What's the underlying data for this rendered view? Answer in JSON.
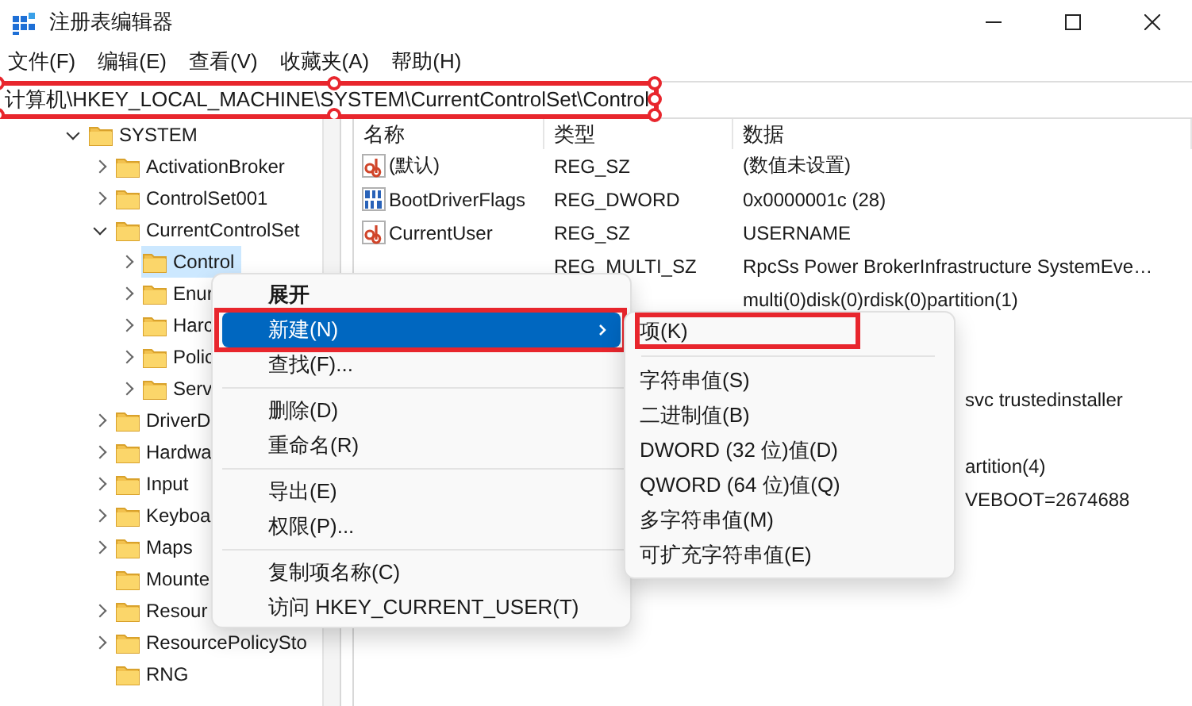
{
  "window": {
    "title": "注册表编辑器"
  },
  "menu_bar": [
    "文件(F)",
    "编辑(E)",
    "查看(V)",
    "收藏夹(A)",
    "帮助(H)"
  ],
  "address_bar": {
    "value": "计算机\\HKEY_LOCAL_MACHINE\\SYSTEM\\CurrentControlSet\\Control",
    "highlighted": true
  },
  "tree": [
    {
      "label": "SYSTEM",
      "expandable": true,
      "expanded": true,
      "selected": false,
      "children": [
        {
          "label": "ActivationBroker",
          "expandable": true,
          "expanded": false,
          "selected": false
        },
        {
          "label": "ControlSet001",
          "expandable": true,
          "expanded": false,
          "selected": false
        },
        {
          "label": "CurrentControlSet",
          "expandable": true,
          "expanded": true,
          "selected": false,
          "children": [
            {
              "label": "Control",
              "expandable": true,
              "expanded": false,
              "selected": true
            },
            {
              "label": "Enur",
              "expandable": true,
              "expanded": false,
              "selected": false
            },
            {
              "label": "Harc",
              "expandable": true,
              "expanded": false,
              "selected": false
            },
            {
              "label": "Polic",
              "expandable": true,
              "expanded": false,
              "selected": false
            },
            {
              "label": "Serv",
              "expandable": true,
              "expanded": false,
              "selected": false
            }
          ]
        },
        {
          "label": "DriverD",
          "expandable": true,
          "expanded": false,
          "selected": false
        },
        {
          "label": "Hardwa",
          "expandable": true,
          "expanded": false,
          "selected": false
        },
        {
          "label": "Input",
          "expandable": true,
          "expanded": false,
          "selected": false
        },
        {
          "label": "Keyboa",
          "expandable": true,
          "expanded": false,
          "selected": false
        },
        {
          "label": "Maps",
          "expandable": true,
          "expanded": false,
          "selected": false
        },
        {
          "label": "Mounte",
          "expandable": false,
          "selected": false
        },
        {
          "label": "Resour",
          "expandable": true,
          "expanded": false,
          "selected": false
        },
        {
          "label": "ResourcePolicySto",
          "expandable": true,
          "expanded": false,
          "selected": false
        },
        {
          "label": "RNG",
          "expandable": false,
          "selected": false
        }
      ]
    }
  ],
  "values": {
    "columns": [
      "名称",
      "类型",
      "数据"
    ],
    "rows": [
      {
        "kind": "string",
        "name": "(默认)",
        "type": "REG_SZ",
        "data": "(数值未设置)"
      },
      {
        "kind": "binary",
        "name": "BootDriverFlags",
        "type": "REG_DWORD",
        "data": "0x0000001c (28)"
      },
      {
        "kind": "string",
        "name": "CurrentUser",
        "type": "REG_SZ",
        "data": "USERNAME"
      },
      {
        "kind": "covered",
        "type": "REG_MULTI_SZ",
        "data": "RpcSs Power BrokerInfrastructure SystemEve…"
      },
      {
        "kind": "covered",
        "data": "multi(0)disk(0)rdisk(0)partition(1)"
      },
      {
        "kind": "blank"
      },
      {
        "kind": "blank"
      },
      {
        "kind": "tail",
        "data": "svc trustedinstaller"
      },
      {
        "kind": "blank"
      },
      {
        "kind": "tail",
        "data": "artition(4)"
      },
      {
        "kind": "tail",
        "data": "VEBOOT=2674688"
      }
    ]
  },
  "context_menu": [
    {
      "kind": "item",
      "label": "展开",
      "bold": true,
      "selected": false,
      "highlighted": false
    },
    {
      "kind": "submenu",
      "label": "新建(N)",
      "bold": false,
      "selected": true,
      "highlighted": true
    },
    {
      "kind": "item",
      "label": "查找(F)...",
      "bold": false,
      "selected": false,
      "highlighted": false
    },
    {
      "kind": "separator"
    },
    {
      "kind": "item",
      "label": "删除(D)",
      "bold": false,
      "selected": false,
      "highlighted": false
    },
    {
      "kind": "item",
      "label": "重命名(R)",
      "bold": false,
      "selected": false,
      "highlighted": false
    },
    {
      "kind": "separator"
    },
    {
      "kind": "item",
      "label": "导出(E)",
      "bold": false,
      "selected": false,
      "highlighted": false
    },
    {
      "kind": "item",
      "label": "权限(P)...",
      "bold": false,
      "selected": false,
      "highlighted": false
    },
    {
      "kind": "separator"
    },
    {
      "kind": "item",
      "label": "复制项名称(C)",
      "bold": false,
      "selected": false,
      "highlighted": false
    },
    {
      "kind": "item",
      "label": "访问 HKEY_CURRENT_USER(T)",
      "bold": false,
      "selected": false,
      "highlighted": false
    }
  ],
  "submenu": [
    {
      "kind": "item",
      "label": "项(K)",
      "highlighted": true
    },
    {
      "kind": "separator"
    },
    {
      "kind": "item",
      "label": "字符串值(S)",
      "highlighted": false
    },
    {
      "kind": "item",
      "label": "二进制值(B)",
      "highlighted": false
    },
    {
      "kind": "item",
      "label": "DWORD (32 位)值(D)",
      "highlighted": false
    },
    {
      "kind": "item",
      "label": "QWORD (64 位)值(Q)",
      "highlighted": false
    },
    {
      "kind": "item",
      "label": "多字符串值(M)",
      "highlighted": false
    },
    {
      "kind": "item",
      "label": "可扩充字符串值(E)",
      "highlighted": false
    }
  ]
}
